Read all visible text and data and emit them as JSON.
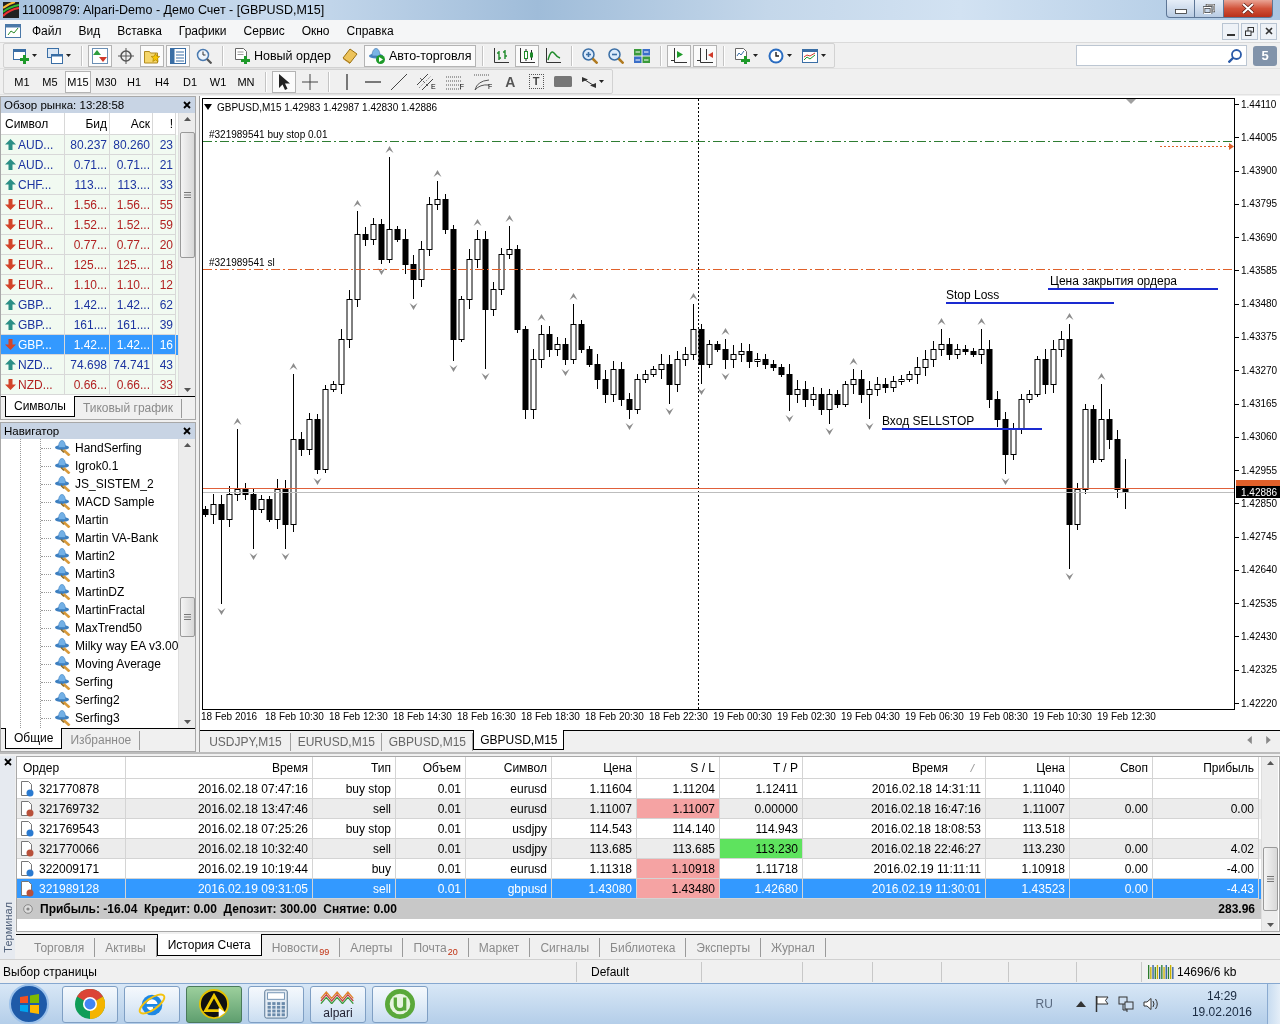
{
  "window": {
    "title": "11009879: Alpari-Demo - Демо Счет - [GBPUSD,M15]"
  },
  "menu": [
    "Файл",
    "Вид",
    "Вставка",
    "Графики",
    "Сервис",
    "Окно",
    "Справка"
  ],
  "toolbar": [
    [
      {
        "kind": "menu",
        "pressed": false
      },
      {
        "kind": "menu",
        "pressed": false
      }
    ],
    [
      {
        "kind": "icon",
        "pressed": true
      },
      {
        "kind": "icon",
        "pressed": false
      },
      {
        "kind": "icon",
        "pressed": true
      },
      {
        "kind": "icon",
        "pressed": true
      },
      {
        "kind": "icon",
        "pressed": false
      }
    ],
    [
      {
        "kind": "text",
        "label": "Новый ордер",
        "pressed": false
      },
      {
        "kind": "icon",
        "pressed": false
      },
      {
        "kind": "text",
        "label": "Авто-торговля",
        "pressed": true
      }
    ],
    [
      {
        "kind": "icon",
        "pressed": false
      },
      {
        "kind": "icon",
        "pressed": true
      },
      {
        "kind": "icon",
        "pressed": false
      }
    ],
    [
      {
        "kind": "icon",
        "pressed": false
      },
      {
        "kind": "icon",
        "pressed": false
      },
      {
        "kind": "icon",
        "pressed": false
      }
    ],
    [
      {
        "kind": "icon",
        "pressed": true
      },
      {
        "kind": "icon",
        "pressed": true
      }
    ],
    [
      {
        "kind": "menu",
        "pressed": false
      },
      {
        "kind": "menu",
        "pressed": false
      },
      {
        "kind": "menu",
        "pressed": false
      }
    ]
  ],
  "messages": {
    "count": "5"
  },
  "timeframes": [
    {
      "label": "M1",
      "selected": false
    },
    {
      "label": "M5",
      "selected": false
    },
    {
      "label": "M15",
      "selected": true
    },
    {
      "label": "M30",
      "selected": false
    },
    {
      "label": "H1",
      "selected": false
    },
    {
      "label": "H4",
      "selected": false
    },
    {
      "label": "D1",
      "selected": false
    },
    {
      "label": "W1",
      "selected": false
    },
    {
      "label": "MN",
      "selected": false
    }
  ],
  "drawing_tools": [
    [
      {
        "kind": "icon",
        "pressed": true
      },
      {
        "kind": "icon",
        "pressed": false
      }
    ],
    [
      {
        "kind": "icon",
        "pressed": false
      },
      {
        "kind": "icon",
        "pressed": false
      },
      {
        "kind": "icon",
        "pressed": false
      },
      {
        "kind": "icon_glyph",
        "glyph": "E",
        "pressed": false
      },
      {
        "kind": "icon_glyph",
        "glyph": "F",
        "pressed": false
      },
      {
        "kind": "icon_glyph",
        "glyph": "F",
        "pressed": false
      },
      {
        "kind": "glyph",
        "glyph": "A",
        "pressed": false
      },
      {
        "kind": "boxed_glyph",
        "glyph": "T",
        "pressed": false
      },
      {
        "kind": "icon",
        "pressed": false
      },
      {
        "kind": "menu",
        "pressed": false
      }
    ]
  ],
  "market_watch": {
    "title": "Обзор рынка: 13:28:58",
    "columns": [
      "Символ",
      "Бид",
      "Аск",
      "!"
    ],
    "rows": [
      {
        "symbol": "AUD...",
        "bid": "80.237",
        "ask": "80.260",
        "spread": "23",
        "kind": "up",
        "selected": false
      },
      {
        "symbol": "AUD...",
        "bid": "0.71...",
        "ask": "0.71...",
        "spread": "21",
        "kind": "up",
        "selected": false
      },
      {
        "symbol": "CHF...",
        "bid": "113....",
        "ask": "113....",
        "spread": "33",
        "kind": "up",
        "selected": false
      },
      {
        "symbol": "EUR...",
        "bid": "1.56...",
        "ask": "1.56...",
        "spread": "55",
        "kind": "down",
        "selected": false
      },
      {
        "symbol": "EUR...",
        "bid": "1.52...",
        "ask": "1.52...",
        "spread": "59",
        "kind": "down",
        "selected": false
      },
      {
        "symbol": "EUR...",
        "bid": "0.77...",
        "ask": "0.77...",
        "spread": "20",
        "kind": "down",
        "selected": false
      },
      {
        "symbol": "EUR...",
        "bid": "125....",
        "ask": "125....",
        "spread": "18",
        "kind": "down",
        "selected": false
      },
      {
        "symbol": "EUR...",
        "bid": "1.10...",
        "ask": "1.10...",
        "spread": "12",
        "kind": "down",
        "selected": false
      },
      {
        "symbol": "GBP...",
        "bid": "1.42...",
        "ask": "1.42...",
        "spread": "62",
        "kind": "up",
        "selected": false
      },
      {
        "symbol": "GBP...",
        "bid": "161....",
        "ask": "161....",
        "spread": "39",
        "kind": "up",
        "selected": false
      },
      {
        "symbol": "GBP...",
        "bid": "1.42...",
        "ask": "1.42...",
        "spread": "16",
        "kind": "down",
        "selected": true
      },
      {
        "symbol": "NZD...",
        "bid": "74.698",
        "ask": "74.741",
        "spread": "43",
        "kind": "up",
        "selected": false
      },
      {
        "symbol": "NZD...",
        "bid": "0.66...",
        "ask": "0.66...",
        "spread": "33",
        "kind": "down",
        "selected": false
      }
    ],
    "tabs": [
      {
        "label": "Символы",
        "selected": true
      },
      {
        "label": "Тиковый график",
        "selected": false
      }
    ]
  },
  "navigator": {
    "title": "Навигатор",
    "items": [
      "HandSerfing",
      "Igrok0.1",
      "JS_SISTEM_2",
      "MACD Sample",
      "Martin",
      "Martin VA-Bank",
      "Martin2",
      "Martin3",
      "MartinDZ",
      "MartinFractal",
      "MaxTrend50",
      "Milky way EA v3.00",
      "Moving Average",
      "Serfing",
      "Serfing2",
      "Serfing3"
    ],
    "tabs": [
      {
        "label": "Общие",
        "selected": true
      },
      {
        "label": "Избранное",
        "selected": false
      }
    ]
  },
  "chart": {
    "header": "GBPUSD,M15 1.42983 1.42987 1.42830 1.42886",
    "order_lines": [
      {
        "kind": "pending",
        "label": "#321989541 buy stop 0.01"
      },
      {
        "kind": "stop_loss",
        "label": "#321989541 sl"
      }
    ],
    "annotations": [
      "Цена закрытия ордера",
      "Stop Loss",
      "Вход SELLSTOP"
    ],
    "price_scale": [
      "1.44110",
      "1.44005",
      "1.43900",
      "1.43795",
      "1.43690",
      "1.43585",
      "1.43480",
      "1.43375",
      "1.43270",
      "1.43165",
      "1.43060",
      "1.42955",
      "1.42850",
      "1.42745",
      "1.42640",
      "1.42535",
      "1.42430",
      "1.42325",
      "1.42220"
    ],
    "bid": "1.42886",
    "time_scale": [
      "18 Feb 2016",
      "18 Feb 10:30",
      "18 Feb 12:30",
      "18 Feb 14:30",
      "18 Feb 16:30",
      "18 Feb 18:30",
      "18 Feb 20:30",
      "18 Feb 22:30",
      "19 Feb 00:30",
      "19 Feb 02:30",
      "19 Feb 04:30",
      "19 Feb 06:30",
      "19 Feb 08:30",
      "19 Feb 10:30",
      "19 Feb 12:30"
    ]
  },
  "chart_tabs": [
    {
      "label": "USDJPY,M15",
      "selected": false
    },
    {
      "label": "EURUSD,M15",
      "selected": false
    },
    {
      "label": "GBPUSD,M15",
      "selected": false
    },
    {
      "label": "GBPUSD,M15",
      "selected": true
    }
  ],
  "terminal": {
    "title": "Терминал",
    "columns": [
      {
        "label": "Ордер",
        "sorted": false
      },
      {
        "label": "Время",
        "sorted": false
      },
      {
        "label": "Тип",
        "sorted": false
      },
      {
        "label": "Объем",
        "sorted": false
      },
      {
        "label": "Символ",
        "sorted": false
      },
      {
        "label": "Цена",
        "sorted": false
      },
      {
        "label": "S / L",
        "sorted": false
      },
      {
        "label": "T / P",
        "sorted": false
      },
      {
        "label": "Время",
        "sorted": true
      },
      {
        "label": "Цена",
        "sorted": false
      },
      {
        "label": "Своп",
        "sorted": false
      },
      {
        "label": "Прибыль",
        "sorted": false
      }
    ],
    "rows": [
      {
        "order": "321770878",
        "open_time": "2016.02.18 07:47:16",
        "type": "buy stop",
        "volume": "0.01",
        "symbol": "eurusd",
        "open_price": "1.11604",
        "sl": "1.11204",
        "tp": "1.12411",
        "close_time": "2016.02.18 14:31:11",
        "close_price": "1.11040",
        "kind": "buy",
        "sl_hit": false,
        "tp_hit": false,
        "selected": false
      },
      {
        "order": "321769732",
        "open_time": "2016.02.18 13:47:46",
        "type": "sell",
        "volume": "0.01",
        "symbol": "eurusd",
        "open_price": "1.11007",
        "sl": "1.11007",
        "tp": "0.00000",
        "close_time": "2016.02.18 16:47:16",
        "close_price": "1.11007",
        "swap": "0.00",
        "profit": "0.00",
        "kind": "sell",
        "sl_hit": true,
        "tp_hit": false,
        "selected": false
      },
      {
        "order": "321769543",
        "open_time": "2016.02.18 07:25:26",
        "type": "buy stop",
        "volume": "0.01",
        "symbol": "usdjpy",
        "open_price": "114.543",
        "sl": "114.140",
        "tp": "114.943",
        "close_time": "2016.02.18 18:08:53",
        "close_price": "113.518",
        "kind": "buy",
        "sl_hit": false,
        "tp_hit": false,
        "selected": false
      },
      {
        "order": "321770066",
        "open_time": "2016.02.18 10:32:40",
        "type": "sell",
        "volume": "0.01",
        "symbol": "usdjpy",
        "open_price": "113.685",
        "sl": "113.685",
        "tp": "113.230",
        "close_time": "2016.02.18 22:46:27",
        "close_price": "113.230",
        "swap": "0.00",
        "profit": "4.02",
        "kind": "sell",
        "sl_hit": false,
        "tp_hit": true,
        "selected": false
      },
      {
        "order": "322009171",
        "open_time": "2016.02.19 10:19:44",
        "type": "buy",
        "volume": "0.01",
        "symbol": "eurusd",
        "open_price": "1.11318",
        "sl": "1.10918",
        "tp": "1.11718",
        "close_time": "2016.02.19 11:11:11",
        "close_price": "1.10918",
        "swap": "0.00",
        "profit": "-4.00",
        "kind": "buy",
        "sl_hit": true,
        "tp_hit": false,
        "selected": false
      },
      {
        "order": "321989128",
        "open_time": "2016.02.19 09:31:05",
        "type": "sell",
        "volume": "0.01",
        "symbol": "gbpusd",
        "open_price": "1.43080",
        "sl": "1.43480",
        "tp": "1.42680",
        "close_time": "2016.02.19 11:30:01",
        "close_price": "1.43523",
        "swap": "0.00",
        "profit": "-4.43",
        "kind": "sell",
        "sl_hit": true,
        "tp_hit": false,
        "selected": true
      }
    ],
    "summary": "Прибыль: -16.04  Кредит: 0.00  Депозит: 300.00  Снятие: 0.00",
    "total": "283.96",
    "tabs": [
      {
        "label": "Торговля",
        "selected": false
      },
      {
        "label": "Активы",
        "selected": false
      },
      {
        "label": "История Счета",
        "selected": true
      },
      {
        "label": "Новости",
        "badge": "99",
        "selected": false
      },
      {
        "label": "Алерты",
        "selected": false
      },
      {
        "label": "Почта",
        "badge": "20",
        "selected": false
      },
      {
        "label": "Маркет",
        "selected": false
      },
      {
        "label": "Сигналы",
        "selected": false
      },
      {
        "label": "Библиотека",
        "selected": false
      },
      {
        "label": "Эксперты",
        "selected": false
      },
      {
        "label": "Журнал",
        "selected": false
      }
    ]
  },
  "status_bar": {
    "hint": "Выбор страницы",
    "profile": "Default",
    "traffic": "14696/6 kb"
  },
  "taskbar": {
    "apps": [
      {
        "highlighted": false
      },
      {
        "highlighted": false
      },
      {
        "highlighted": true
      },
      {
        "highlighted": false
      },
      {
        "highlighted": false,
        "label": "alpari"
      },
      {
        "highlighted": false
      }
    ],
    "language": "RU",
    "time": "14:29",
    "date": "19.02.2016"
  }
}
